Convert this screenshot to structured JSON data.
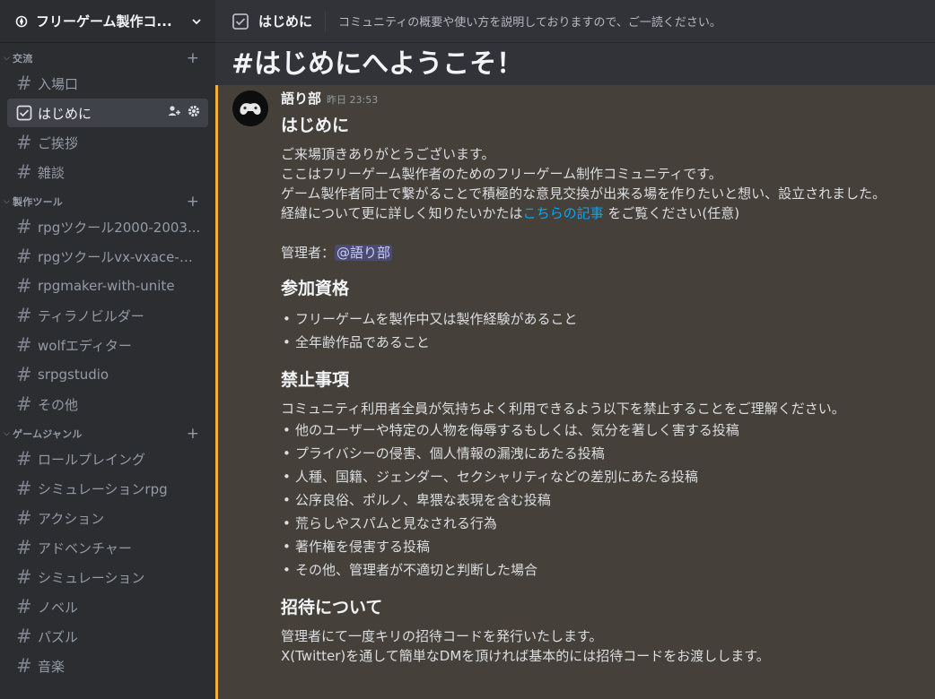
{
  "server": {
    "name": "フリーゲーム製作コ..."
  },
  "categories": [
    {
      "label": "交流",
      "channels": [
        {
          "label": "入場口"
        },
        {
          "label": "はじめに",
          "active": true
        },
        {
          "label": "ご挨拶"
        },
        {
          "label": "雑談"
        }
      ]
    },
    {
      "label": "製作ツール",
      "channels": [
        {
          "label": "rpgツクール2000-2003..."
        },
        {
          "label": "rpgツクールvx-vxace-m..."
        },
        {
          "label": "rpgmaker-with-unite"
        },
        {
          "label": "ティラノビルダー"
        },
        {
          "label": "wolfエディター"
        },
        {
          "label": "srpgstudio"
        },
        {
          "label": "その他"
        }
      ]
    },
    {
      "label": "ゲームジャンル",
      "channels": [
        {
          "label": "ロールプレイング"
        },
        {
          "label": "シミュレーションrpg"
        },
        {
          "label": "アクション"
        },
        {
          "label": "アドベンチャー"
        },
        {
          "label": "シミュレーション"
        },
        {
          "label": "ノベル"
        },
        {
          "label": "パズル"
        },
        {
          "label": "音楽"
        }
      ]
    }
  ],
  "topbar": {
    "channel_name": "はじめに",
    "topic": "コミュニティの概要や使い方を説明しておりますので、ご一読ください。"
  },
  "welcome_title": "#はじめにへようこそ！",
  "message": {
    "author": "語り部",
    "timestamp": "昨日 23:53",
    "h_intro": "はじめに",
    "intro_lines": [
      "ご来場頂きありがとうございます。",
      "ここはフリーゲーム製作者のためのフリーゲーム制作コミュニティです。",
      "ゲーム製作者同士で繋がることで積極的な意見交換が出来る場を作りたいと想い、設立されました。"
    ],
    "history_pre": "経緯について更に詳しく知りたいかたは",
    "history_link": "こちらの記事",
    "history_post": " をご覧ください(任意)",
    "admin_label": "管理者：",
    "admin_mention": "@語り部",
    "h_qual": "参加資格",
    "qual_items": [
      "フリーゲームを製作中又は製作経験があること",
      "全年齢作品であること"
    ],
    "h_prohib": "禁止事項",
    "prohib_intro": "コミュニティ利用者全員が気持ちよく利用できるよう以下を禁止することをご理解ください。",
    "prohib_items": [
      "他のユーザーや特定の人物を侮辱するもしくは、気分を著しく害する投稿",
      "プライバシーの侵害、個人情報の漏洩にあたる投稿",
      "人種、国籍、ジェンダー、セクシャリティなどの差別にあたる投稿",
      "公序良俗、ポルノ、卑猥な表現を含む投稿",
      "荒らしやスパムと見なされる行為",
      "著作権を侵害する投稿",
      "その他、管理者が不適切と判断した場合"
    ],
    "h_invite": "招待について",
    "invite_lines": [
      "管理者にて一度キリの招待コードを発行いたします。",
      "X(Twitter)を通して簡単なDMを頂ければ基本的には招待コードをお渡しします。"
    ]
  },
  "colors": {
    "accent_bar": "#f0b232",
    "link": "#00a8fc",
    "mention_bg": "#5865f2"
  },
  "icons": [
    "server-icon",
    "chevron-down-icon",
    "rules-channel-icon",
    "hash-icon",
    "add-member-icon",
    "gear-icon",
    "plus-icon"
  ]
}
